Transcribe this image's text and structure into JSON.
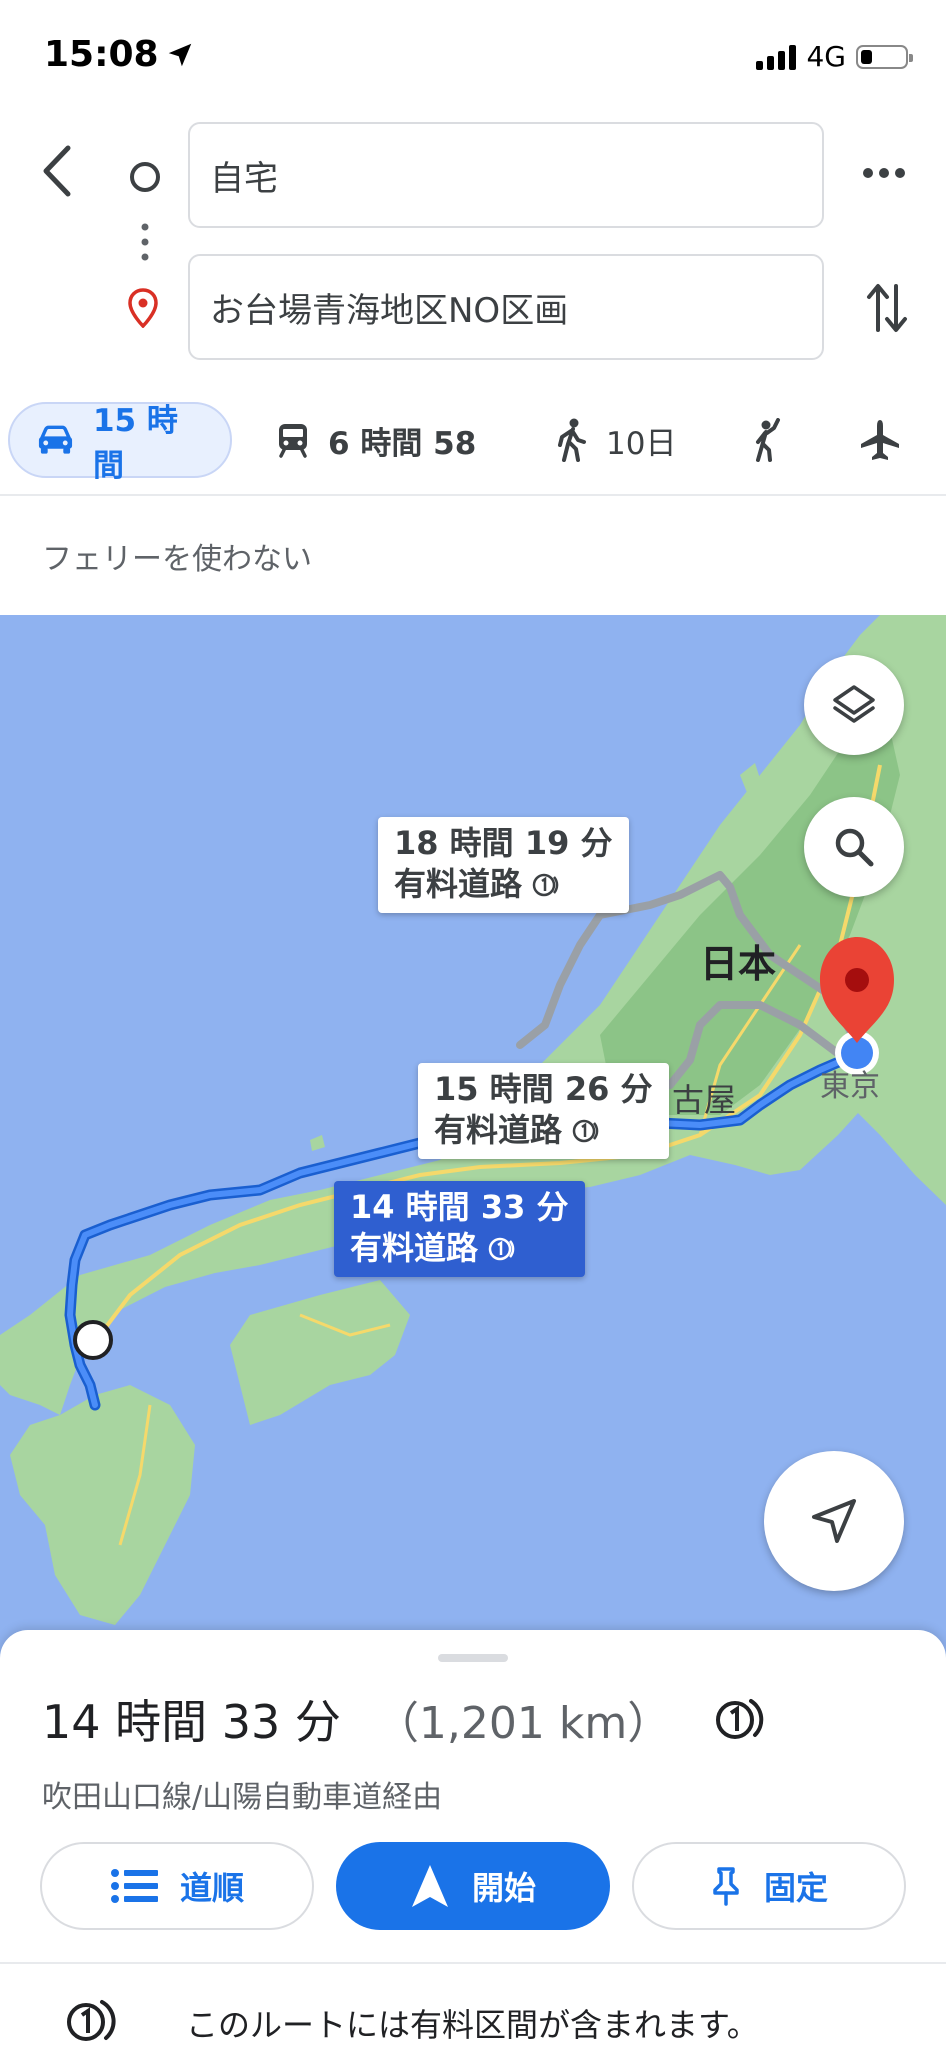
{
  "status_bar": {
    "time": "15:08",
    "network": "4G"
  },
  "route": {
    "origin": "自宅",
    "destination": "お台場青海地区NO区画"
  },
  "modes": [
    {
      "name": "car",
      "label": "15 時間",
      "selected": true
    },
    {
      "name": "transit",
      "label": "6 時間 58"
    },
    {
      "name": "walk",
      "label": "10日"
    },
    {
      "name": "ride-hailing",
      "label": ""
    },
    {
      "name": "flight",
      "label": ""
    }
  ],
  "options": {
    "label": "フェリーを使わない"
  },
  "map": {
    "callouts": [
      {
        "line1": "18 時間 19 分",
        "line2": "有料道路"
      },
      {
        "line1": "15 時間 26 分",
        "line2": "有料道路"
      },
      {
        "line1": "14 時間 33 分",
        "line2": "有料道路"
      }
    ],
    "labels": {
      "japan": "日本",
      "tokyo": "東京",
      "nagoya": "古屋"
    }
  },
  "summary": {
    "duration": "14 時間 33 分",
    "distance": "（1,201 km）",
    "via": "吹田山口線/山陽自動車道経由"
  },
  "actions": {
    "directions": "道順",
    "start": "開始",
    "pin": "固定"
  },
  "toll_note": "このルートには有料区間が含まれます。",
  "colors": {
    "accent": "#1a73e8",
    "route": "#4285f4",
    "alt_route": "#9aa0a6",
    "water": "#8fb2f0",
    "land": "#a8d5a0"
  }
}
